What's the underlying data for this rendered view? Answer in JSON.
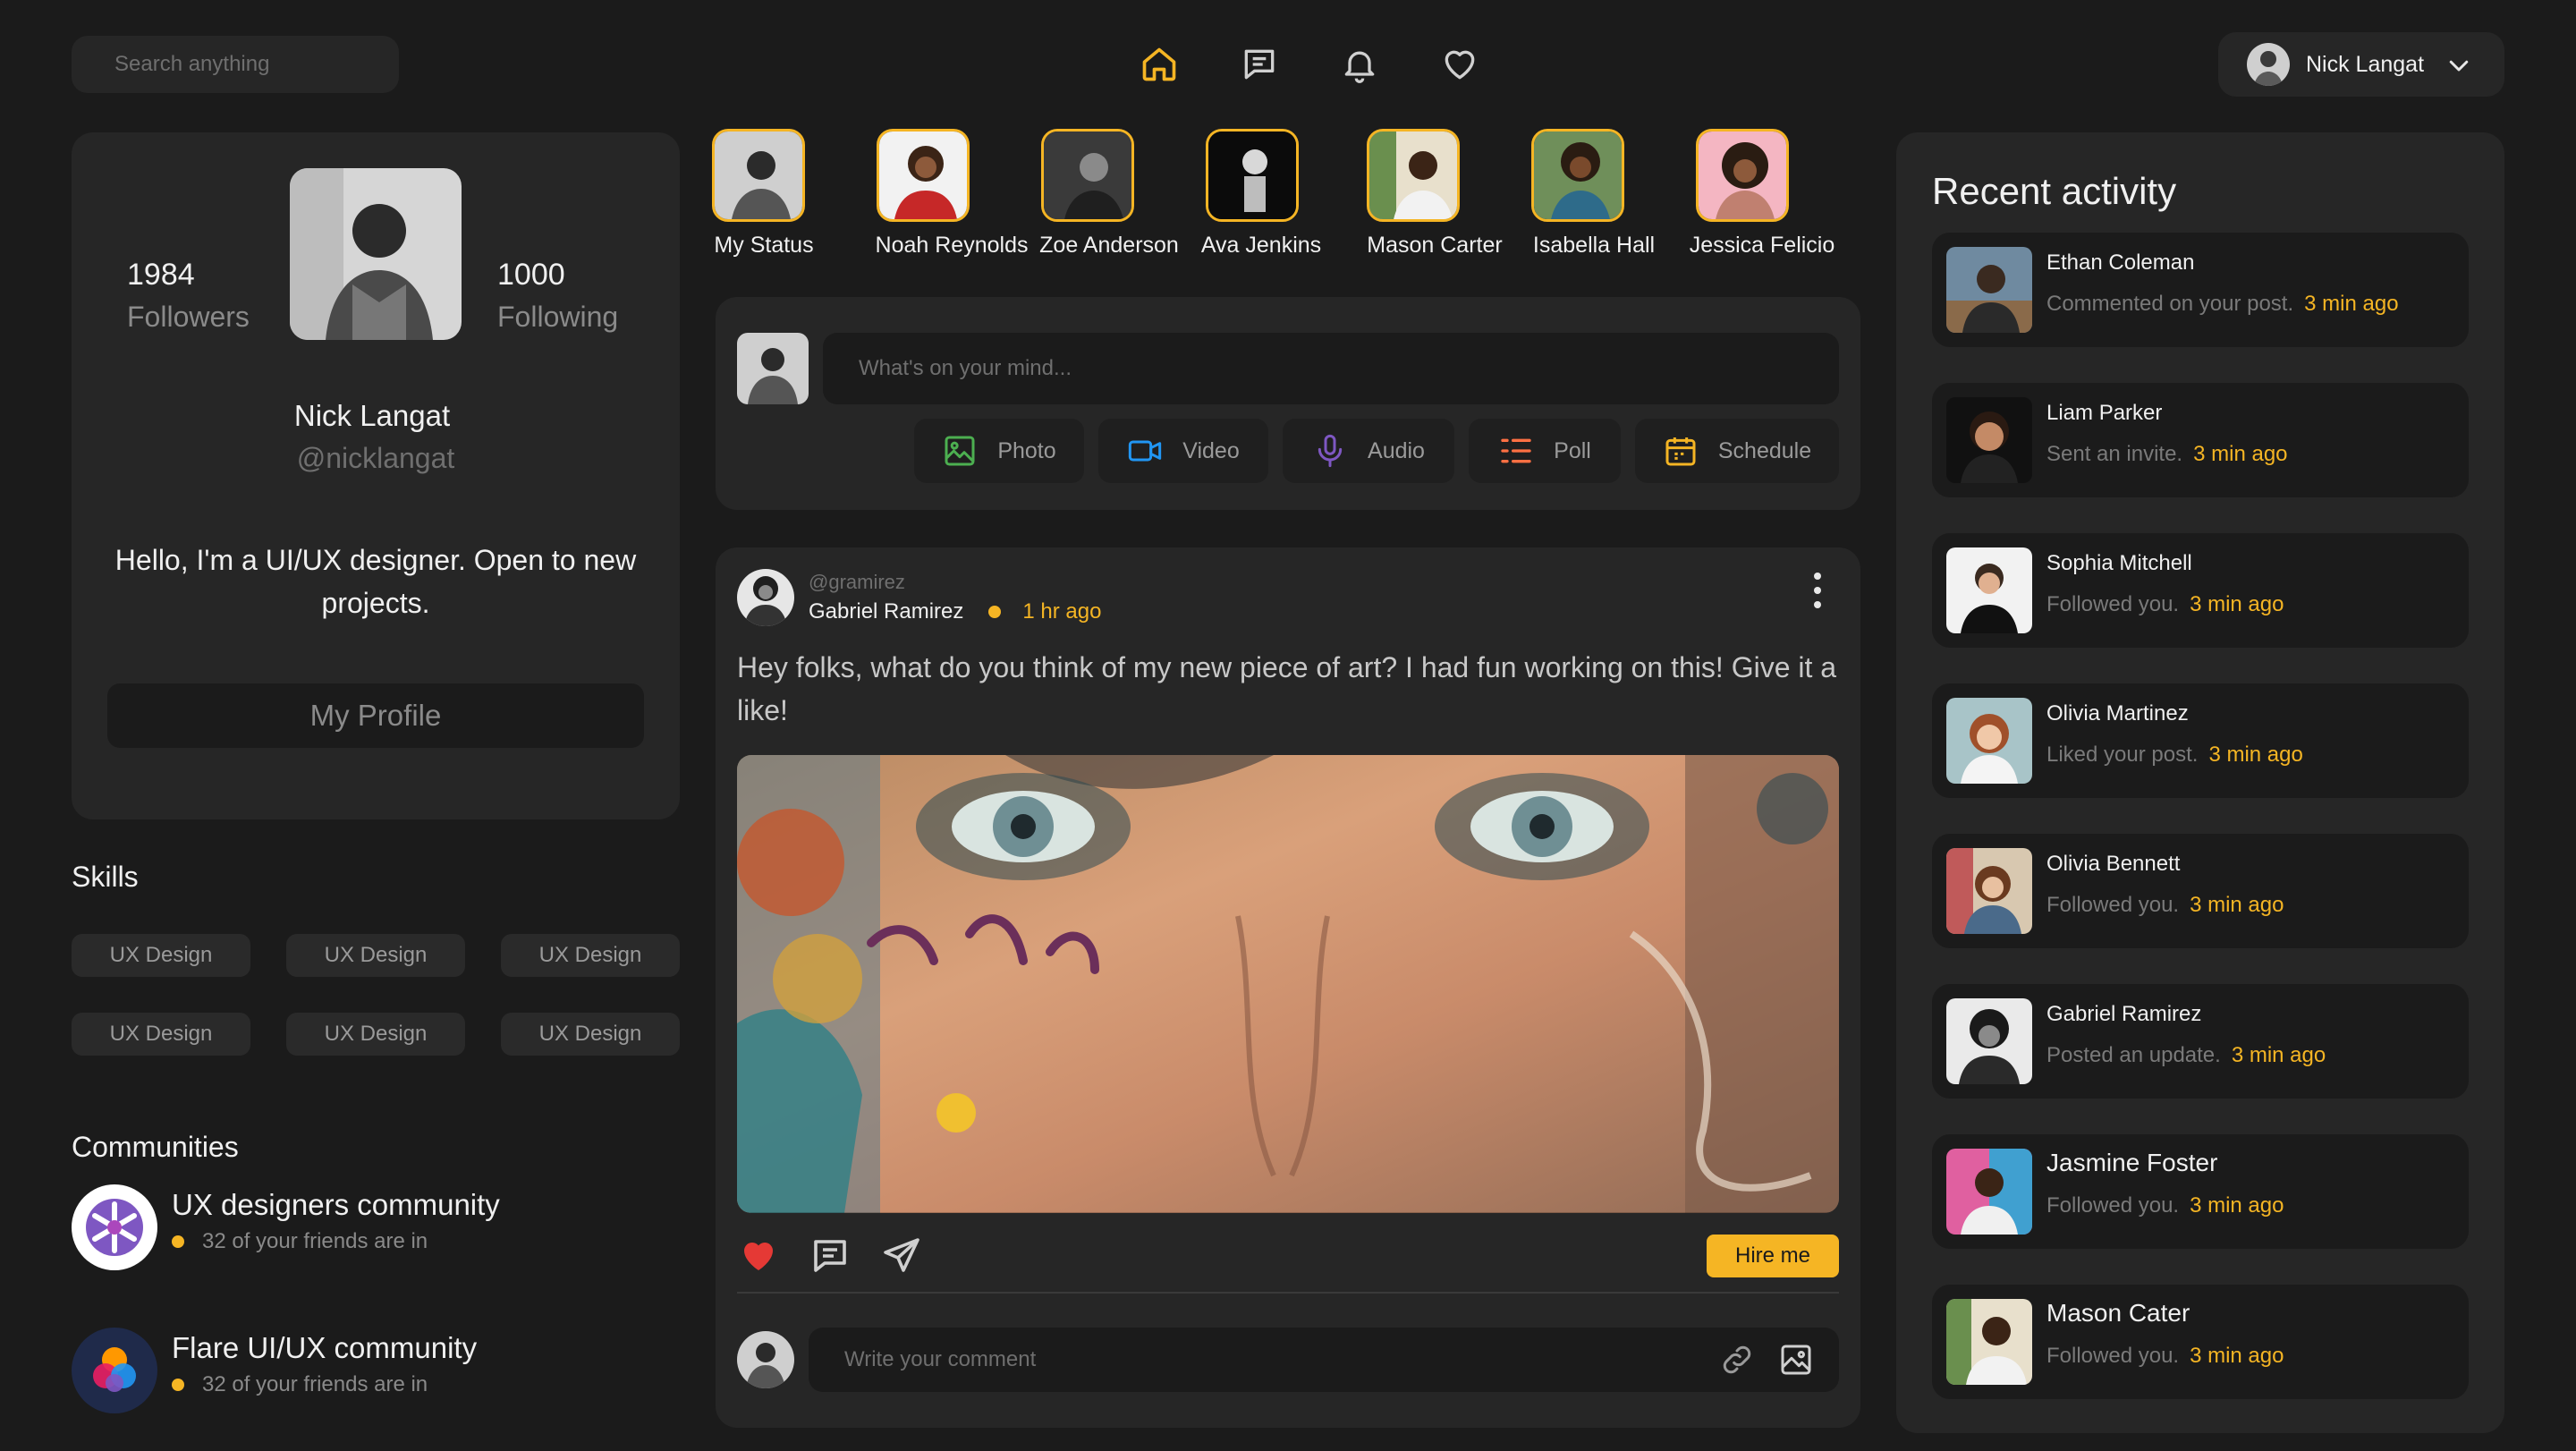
{
  "search": {
    "placeholder": "Search anything"
  },
  "user": {
    "name": "Nick Langat"
  },
  "profile": {
    "followers_count": "1984",
    "followers_label": "Followers",
    "following_count": "1000",
    "following_label": "Following",
    "name": "Nick Langat",
    "handle": "@nicklangat",
    "bio": "Hello, I'm a UI/UX designer. Open to new projects.",
    "button": "My Profile"
  },
  "skills": {
    "title": "Skills",
    "items": [
      "UX Design",
      "UX Design",
      "UX Design",
      "UX Design",
      "UX Design",
      "UX Design"
    ]
  },
  "communities": {
    "title": "Communities",
    "items": [
      {
        "name": "UX designers community",
        "sub": "32 of your friends are in"
      },
      {
        "name": "Flare UI/UX community",
        "sub": "32 of your friends are in"
      }
    ]
  },
  "stories": [
    "My Status",
    "Noah Reynolds",
    "Zoe Anderson",
    "Ava Jenkins",
    "Mason Carter",
    "Isabella Hall",
    "Jessica Felicio"
  ],
  "composer": {
    "placeholder": "What's on your mind...",
    "actions": [
      "Photo",
      "Video",
      "Audio",
      "Poll",
      "Schedule"
    ]
  },
  "post": {
    "handle": "@gramirez",
    "author": "Gabriel Ramirez",
    "time": "1 hr ago",
    "text": "Hey folks, what do you think of my new piece of art? I had fun working on this! Give it a like!",
    "hire_label": "Hire me",
    "comment_placeholder": "Write your comment"
  },
  "activity": {
    "title": "Recent activity",
    "items": [
      {
        "name": "Ethan Coleman",
        "action": "Commented on your post.",
        "time": "3 min ago"
      },
      {
        "name": "Liam Parker",
        "action": "Sent an invite.",
        "time": "3 min ago"
      },
      {
        "name": "Sophia Mitchell",
        "action": "Followed you.",
        "time": "3 min ago"
      },
      {
        "name": "Olivia Martinez",
        "action": "Liked your post.",
        "time": "3 min ago"
      },
      {
        "name": "Olivia Bennett",
        "action": "Followed you.",
        "time": "3 min ago"
      },
      {
        "name": "Gabriel Ramirez",
        "action": "Posted an update.",
        "time": "3 min ago"
      },
      {
        "name": "Jasmine Foster",
        "action": "Followed you.",
        "time": "3 min ago"
      },
      {
        "name": "Mason Cater",
        "action": "Followed you.",
        "time": "3 min ago"
      }
    ]
  },
  "colors": {
    "accent": "#f5b524",
    "background": "#1b1b1b",
    "card": "#262626",
    "like": "#e53935"
  },
  "icons": [
    "home-icon",
    "chat-icon",
    "bell-icon",
    "heart-icon",
    "chevron-down-icon",
    "photo-icon",
    "video-icon",
    "mic-icon",
    "poll-icon",
    "calendar-icon",
    "kebab-icon",
    "share-icon",
    "link-icon",
    "image-icon"
  ]
}
